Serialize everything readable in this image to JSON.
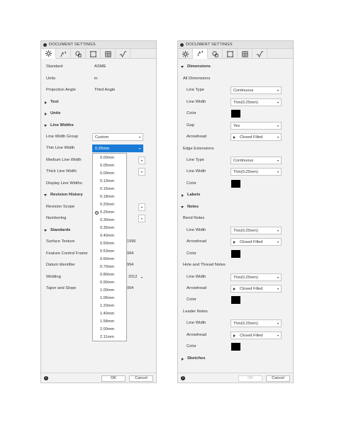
{
  "left_panel": {
    "title": "DOCUMENT SETTINGS",
    "general": [
      {
        "label": "Standard",
        "value": "ASME"
      },
      {
        "label": "Units",
        "value": "in"
      },
      {
        "label": "Projection Angle",
        "value": "Third Angle"
      }
    ],
    "sections": {
      "text": "Text",
      "units": "Units",
      "line_widths": "Line Widths",
      "revision_history": "Revision History",
      "standards": "Standards"
    },
    "line_widths": {
      "group_label": "Line Width Group",
      "group_value": "Custom",
      "thin_label": "Thin Line Width",
      "thin_value": "0.25mm",
      "medium_label": "Medium Line Width",
      "thick_label": "Thick Line Width",
      "display_label": "Display Line Widths"
    },
    "revision": {
      "scope_label": "Revision Scope",
      "numbering_label": "Numbering"
    },
    "standards": [
      {
        "label": "Surface Texture",
        "value": "1996"
      },
      {
        "label": "Feature Control Frame",
        "value": "994"
      },
      {
        "label": "Datum Identifier",
        "value": "994"
      },
      {
        "label": "Welding",
        "value": "2012"
      },
      {
        "label": "Taper and Slope",
        "value": "994"
      }
    ],
    "footer": {
      "ok": "OK",
      "cancel": "Cancel"
    }
  },
  "dropdown": {
    "options": [
      "0.00mm",
      "0.05mm",
      "0.09mm",
      "0.13mm",
      "0.15mm",
      "0.18mm",
      "0.20mm",
      "0.25mm",
      "0.30mm",
      "0.35mm",
      "0.40mm",
      "0.50mm",
      "0.53mm",
      "0.60mm",
      "0.70mm",
      "0.80mm",
      "0.90mm",
      "1.00mm",
      "1.06mm",
      "1.20mm",
      "1.40mm",
      "1.58mm",
      "2.00mm",
      "2.11mm"
    ],
    "selected": "0.25mm"
  },
  "right_panel": {
    "title": "DOCUMENT SETTINGS",
    "sections": {
      "dimensions": "Dimensions",
      "labels": "Labels",
      "notes": "Notes",
      "sketches": "Sketches"
    },
    "all_dimensions": {
      "heading": "All Dimensions",
      "line_type_label": "Line Type",
      "line_type_value": "Continuous",
      "line_width_label": "Line Width",
      "line_width_value": "Thin(0.25mm)",
      "color_label": "Color",
      "gap_label": "Gap",
      "gap_value": "Yes",
      "arrowhead_label": "Arrowhead",
      "arrowhead_value": "Closed Filled"
    },
    "edge_extensions": {
      "heading": "Edge Extensions",
      "line_type_label": "Line Type",
      "line_type_value": "Continuous",
      "line_width_label": "Line Width",
      "line_width_value": "Thin(0.25mm)",
      "color_label": "Color"
    },
    "bend_notes": {
      "heading": "Bend Notes",
      "line_width_label": "Line Width",
      "line_width_value": "Thin(0.25mm)",
      "arrowhead_label": "Arrowhead",
      "arrowhead_value": "Closed Filled",
      "color_label": "Color"
    },
    "hole_thread_notes": {
      "heading": "Hole and Thread Notes",
      "line_width_label": "Line Width",
      "line_width_value": "Thin(0.25mm)",
      "arrowhead_label": "Arrowhead",
      "arrowhead_value": "Closed Filled",
      "color_label": "Color"
    },
    "leader_notes": {
      "heading": "Leader Notes",
      "line_width_label": "Line Width",
      "line_width_value": "Thin(0.25mm)",
      "arrowhead_label": "Arrowhead",
      "arrowhead_value": "Closed Filled",
      "color_label": "Color"
    },
    "footer": {
      "ok": "OK",
      "cancel": "Cancel"
    }
  },
  "colors": {
    "accent": "#1a7bd6",
    "swatch": "#000000",
    "panel_bg": "#f2f2f2"
  },
  "icons": [
    "gear-icon",
    "dimension-icon",
    "layers-icon",
    "frame-icon",
    "table-icon",
    "sqrt-icon",
    "info-icon"
  ]
}
